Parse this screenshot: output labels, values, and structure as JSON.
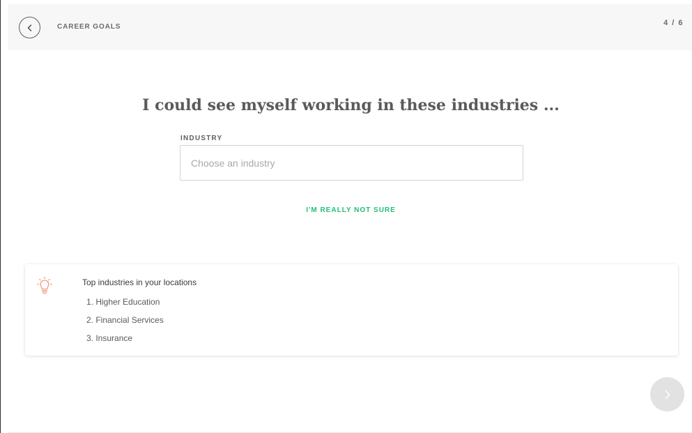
{
  "header": {
    "back_icon": "chevron-left-icon",
    "step_title": "CAREER GOALS",
    "step_counter": "4 / 6"
  },
  "main": {
    "question": "I could see myself working in these industries ...",
    "industry_field": {
      "label": "INDUSTRY",
      "placeholder": "Choose an industry",
      "value": ""
    },
    "not_sure_link": "I'M REALLY NOT SURE"
  },
  "tip": {
    "icon": "lightbulb-icon",
    "title": "Top industries in your locations",
    "items": [
      "1. Higher Education",
      "2. Financial Services",
      "3. Insurance"
    ]
  },
  "footer": {
    "next_icon": "chevron-right-icon"
  },
  "colors": {
    "accent_green": "#1fbf7a",
    "tip_icon": "#f08a6a",
    "next_button": "#e2e2e2"
  }
}
